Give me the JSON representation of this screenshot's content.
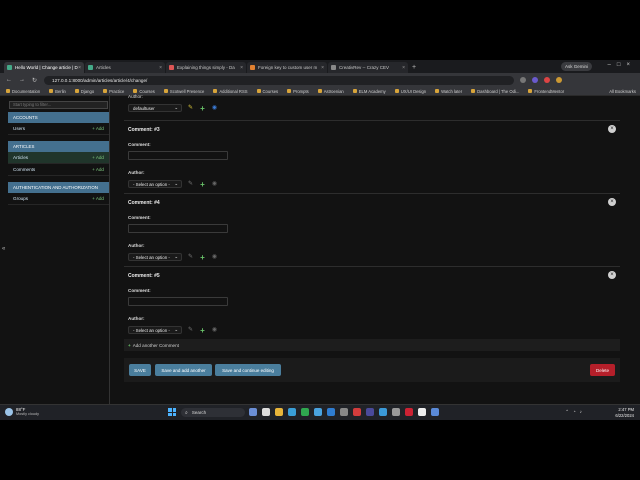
{
  "browser": {
    "tabs": [
      {
        "label": "Hello World | Change article | D",
        "active": true
      },
      {
        "label": "Articles",
        "active": false
      },
      {
        "label": "Explaining things simply - Da",
        "active": false
      },
      {
        "label": "Foreign key to custom user m",
        "active": false
      },
      {
        "label": "CreativRev -- Crazy CEV",
        "active": false
      }
    ],
    "new_tab": "+",
    "profile": "Ask Gemini",
    "url": "127.0.0.1:8000/admin/articles/article/4/change/",
    "nav": {
      "back": "←",
      "forward": "→",
      "reload": "↻"
    },
    "bookmarks": [
      "Documentation",
      "Berlin",
      "Django",
      "Practice",
      "Courses",
      "Scotwell Presence",
      "Additional RSS",
      "Courses",
      "Prompts",
      "Astroenian",
      "ELM Academy",
      "UX/UI Design",
      "Watch later",
      "Dashboard | The Odi...",
      "FrontendMentor"
    ],
    "all_bookmarks": "All Bookmarks"
  },
  "sidebar": {
    "filter_placeholder": "Start typing to filter...",
    "modules": [
      {
        "title": "ACCOUNTS",
        "items": [
          {
            "label": "Users",
            "add": "+ Add",
            "selected": false
          }
        ]
      },
      {
        "title": "ARTICLES",
        "items": [
          {
            "label": "Articles",
            "add": "+ Add",
            "selected": true
          },
          {
            "label": "Comments",
            "add": "+ Add",
            "selected": false
          }
        ]
      },
      {
        "title": "AUTHENTICATION AND AUTHORIZATION",
        "items": [
          {
            "label": "Groups",
            "add": "+ Add",
            "selected": false
          }
        ]
      }
    ]
  },
  "main": {
    "partial_label": "Author:",
    "top_author_value": "defaultuser",
    "inlines": [
      {
        "title": "Comment: #3",
        "comment_label": "Comment:",
        "author_label": "Author:",
        "author_placeholder": "- Select an option -"
      },
      {
        "title": "Comment: #4",
        "comment_label": "Comment:",
        "author_label": "Author:",
        "author_placeholder": "- Select an option -"
      },
      {
        "title": "Comment: #5",
        "comment_label": "Comment:",
        "author_label": "Author:",
        "author_placeholder": "- Select an option -"
      }
    ],
    "add_another": "Add another Comment",
    "buttons": {
      "save": "SAVE",
      "save_add": "Save and add another",
      "save_continue": "Save and continue editing",
      "delete": "Delete"
    }
  },
  "taskbar": {
    "weather_temp": "88°F",
    "weather_desc": "Mostly cloudy",
    "search_label": "Search",
    "time": "2:47 PM",
    "date": "6/22/2024"
  },
  "colors": {
    "accent": "#44708f",
    "add_green": "#6ac46a",
    "delete_red": "#b51f2a"
  }
}
